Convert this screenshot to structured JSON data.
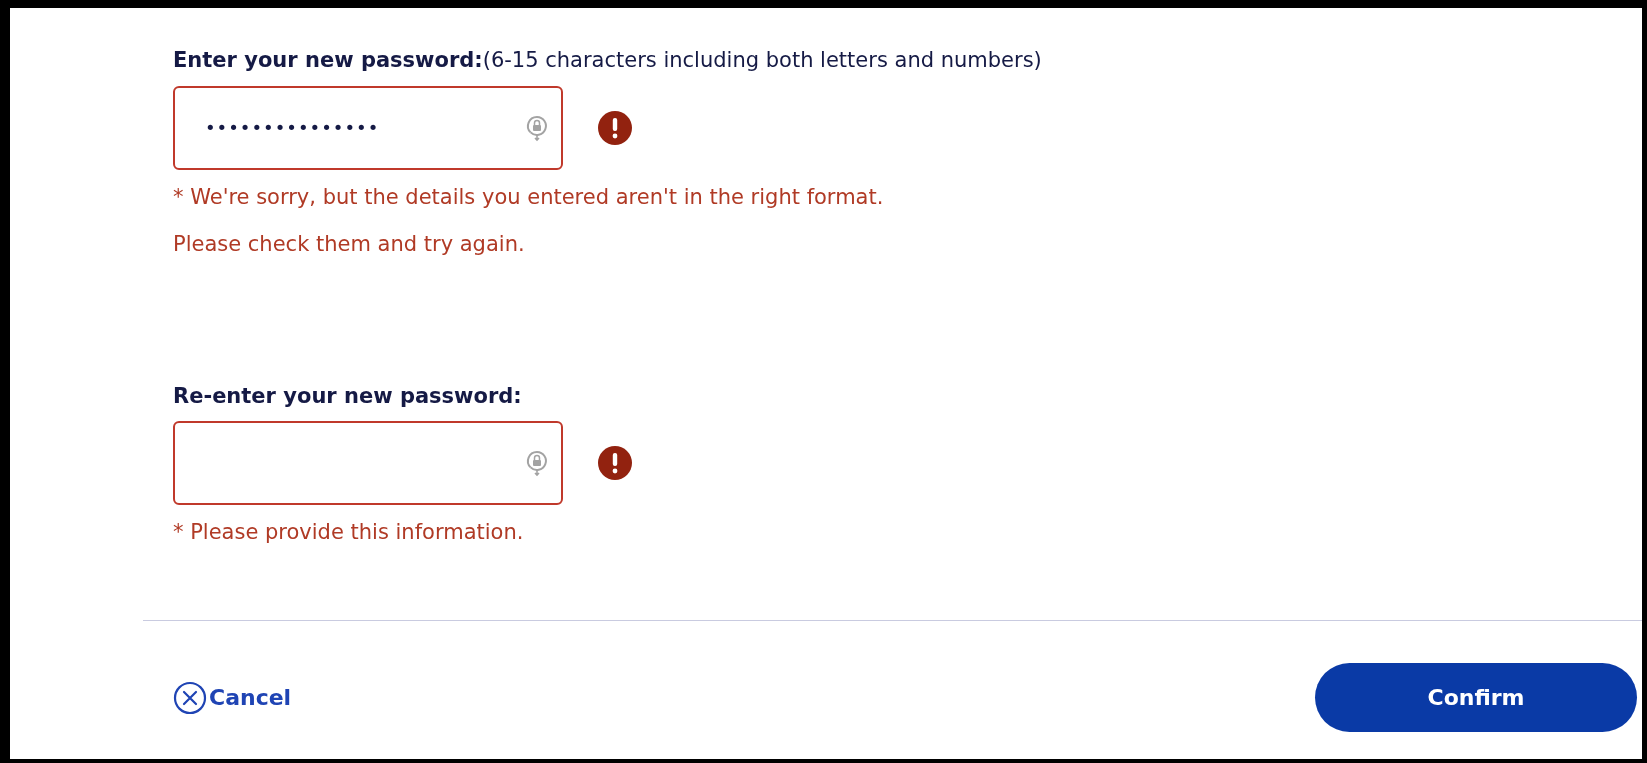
{
  "fields": [
    {
      "label": "Enter your new password:",
      "hint": "(6-15 characters including both letters and numbers)",
      "value": "•••••••••••••••",
      "error": true,
      "messages": [
        "* We're sorry, but the details you entered aren't in the right format.",
        "Please check them and try again."
      ]
    },
    {
      "label": "Re-enter your new password:",
      "error": true,
      "messages": [
        "* Please provide this information."
      ]
    }
  ],
  "actions": {
    "cancel": "Cancel",
    "confirm": "Confirm"
  }
}
